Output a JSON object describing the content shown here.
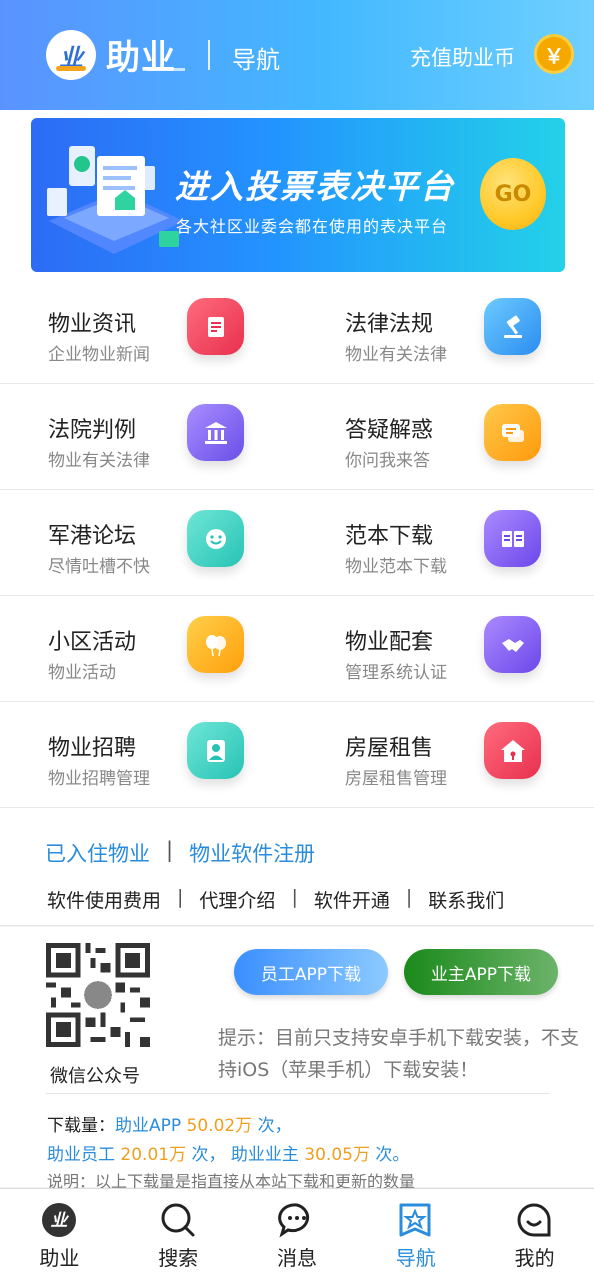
{
  "header": {
    "logo_glyph": "业",
    "logo_text": "助业",
    "title": "导航",
    "recharge_label": "充值助业币",
    "coin_symbol": "￥"
  },
  "banner": {
    "title": "进入投票表决平台",
    "subtitle": "各大社区业委会都在使用的表决平台",
    "go_label": "GO"
  },
  "grid": [
    {
      "title": "物业资讯",
      "sub": "企业物业新闻",
      "icon": "news-icon",
      "color": "#f0425f"
    },
    {
      "title": "法律法规",
      "sub": "物业有关法律",
      "icon": "gavel-icon",
      "color": "#3fa3f0"
    },
    {
      "title": "法院判例",
      "sub": "物业有关法律",
      "icon": "courthouse-icon",
      "color": "#8466ee"
    },
    {
      "title": "答疑解惑",
      "sub": "你问我来答",
      "icon": "chat-icon",
      "color": "#ffaa14"
    },
    {
      "title": "军港论坛",
      "sub": "尽情吐槽不快",
      "icon": "smile-icon",
      "color": "#39d3c3"
    },
    {
      "title": "范本下载",
      "sub": "物业范本下载",
      "icon": "book-icon",
      "color": "#8a5ef0"
    },
    {
      "title": "小区活动",
      "sub": "物业活动",
      "icon": "balloon-icon",
      "color": "#ffb01a"
    },
    {
      "title": "物业配套",
      "sub": "管理系统认证",
      "icon": "handshake-icon",
      "color": "#8a5ef0"
    },
    {
      "title": "物业招聘",
      "sub": "物业招聘管理",
      "icon": "person-icon",
      "color": "#39d3c3"
    },
    {
      "title": "房屋租售",
      "sub": "房屋租售管理",
      "icon": "house-icon",
      "color": "#f0425f"
    }
  ],
  "links": {
    "primary": [
      "已入住物业",
      "物业软件注册"
    ],
    "secondary": [
      "软件使用费用",
      "代理介绍",
      "软件开通",
      "联系我们"
    ],
    "separator": "|"
  },
  "download": {
    "qr_caption": "微信公众号",
    "staff_btn": "员工APP下载",
    "owner_btn": "业主APP下载",
    "tip": "提示：目前只支持安卓手机下载安装，不支持iOS（苹果手机）下载安装！",
    "stats_label": "下载量：",
    "app_name": "助业APP",
    "app_count": "50.02万",
    "times": "次，",
    "staff_name": "助业员工",
    "staff_count": "20.01万",
    "times2": "次，",
    "owner_name": "助业业主",
    "owner_count": "30.05万",
    "times3": "次。",
    "note": "说明：以上下载量是指直接从本站下载和更新的数量"
  },
  "tabbar": [
    {
      "label": "助业",
      "icon": "logo-icon",
      "active": false
    },
    {
      "label": "搜索",
      "icon": "search-icon",
      "active": false
    },
    {
      "label": "消息",
      "icon": "message-icon",
      "active": false
    },
    {
      "label": "导航",
      "icon": "star-nav-icon",
      "active": true
    },
    {
      "label": "我的",
      "icon": "profile-icon",
      "active": false
    }
  ]
}
